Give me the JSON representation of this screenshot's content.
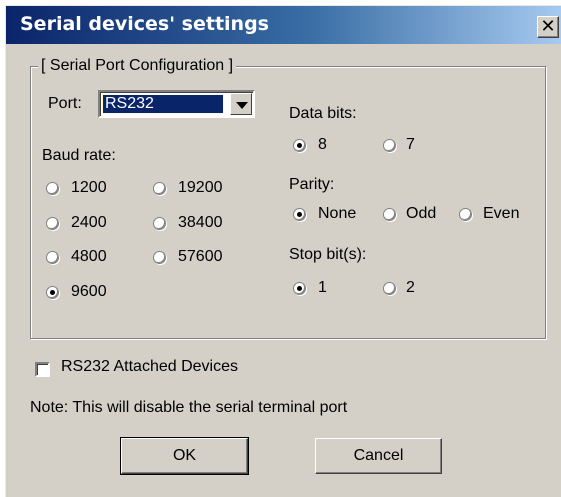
{
  "window": {
    "title": "Serial devices' settings",
    "close_glyph": "✕"
  },
  "group": {
    "legend": "[ Serial Port Configuration ]"
  },
  "port": {
    "label": "Port:",
    "selected": "RS232"
  },
  "baud": {
    "label": "Baud rate:",
    "options": [
      {
        "label": "1200",
        "checked": false
      },
      {
        "label": "19200",
        "checked": false
      },
      {
        "label": "2400",
        "checked": false
      },
      {
        "label": "38400",
        "checked": false
      },
      {
        "label": "4800",
        "checked": false
      },
      {
        "label": "57600",
        "checked": false
      },
      {
        "label": "9600",
        "checked": true
      }
    ]
  },
  "data_bits": {
    "label": "Data bits:",
    "options": [
      {
        "label": "8",
        "checked": true
      },
      {
        "label": "7",
        "checked": false
      }
    ]
  },
  "parity": {
    "label": "Parity:",
    "options": [
      {
        "label": "None",
        "checked": true
      },
      {
        "label": "Odd",
        "checked": false
      },
      {
        "label": "Even",
        "checked": false
      }
    ]
  },
  "stop_bits": {
    "label": "Stop bit(s):",
    "options": [
      {
        "label": "1",
        "checked": true
      },
      {
        "label": "2",
        "checked": false
      }
    ]
  },
  "attached": {
    "label": "RS232 Attached Devices",
    "checked": false
  },
  "note": "Note: This will disable the serial terminal port",
  "buttons": {
    "ok": "OK",
    "cancel": "Cancel"
  }
}
